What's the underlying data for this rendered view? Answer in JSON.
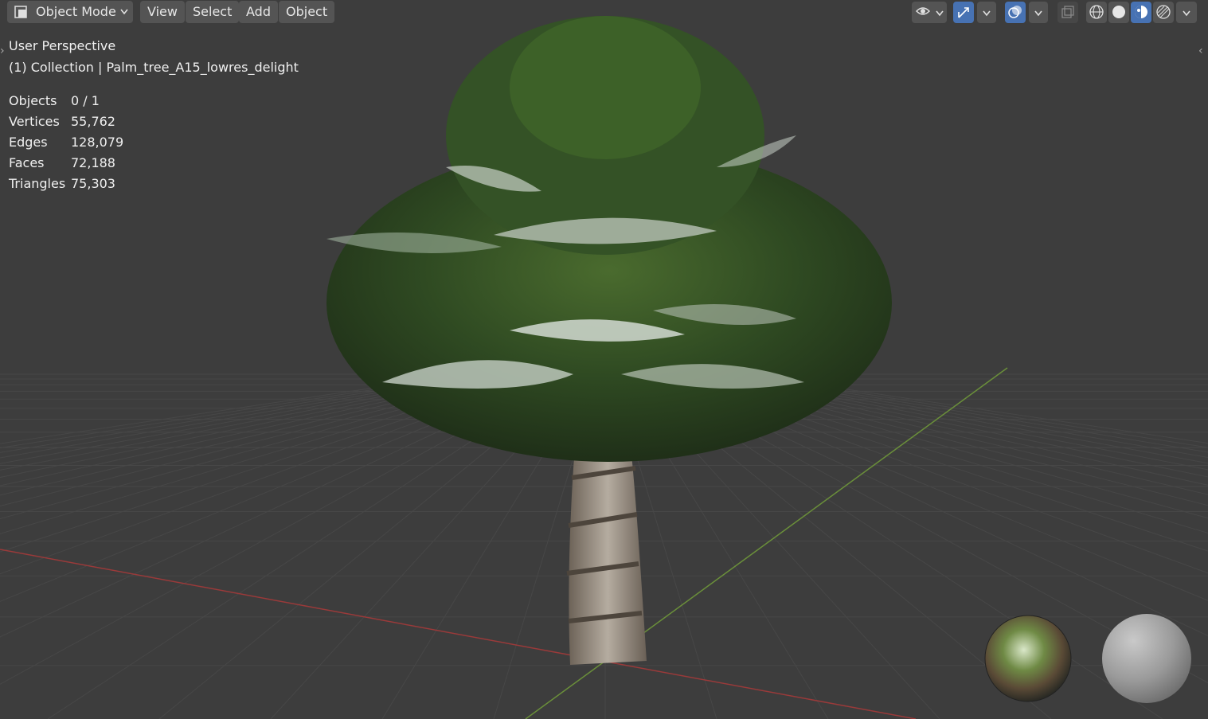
{
  "header": {
    "mode_label": "Object Mode",
    "menus": [
      "View",
      "Select",
      "Add",
      "Object"
    ]
  },
  "header_right": {
    "icons": [
      "visibility-icon",
      "gizmo-icon",
      "overlay-icon",
      "xray-icon",
      "wireframe-shading-icon",
      "solid-shading-icon",
      "material-preview-icon",
      "rendered-shading-icon"
    ],
    "active_color": "#4772b3"
  },
  "viewport": {
    "view_name": "User Perspective",
    "collection_line": "(1) Collection | Palm_tree_A15_lowres_delight",
    "stats": [
      {
        "label": "Objects",
        "value": "0 / 1"
      },
      {
        "label": "Vertices",
        "value": "55,762"
      },
      {
        "label": "Edges",
        "value": "128,079"
      },
      {
        "label": "Faces",
        "value": "72,188"
      },
      {
        "label": "Triangles",
        "value": "75,303"
      }
    ],
    "axis_x_color": "#9a3a3a",
    "axis_y_color": "#6a8f3a",
    "background_color": "#3d3d3d"
  }
}
